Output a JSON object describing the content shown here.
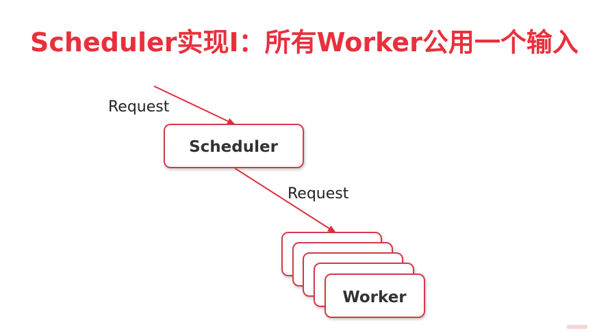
{
  "title": "Scheduler实现I：所有Worker公用一个输入",
  "diagram": {
    "input_label": "Request",
    "scheduler_label": "Scheduler",
    "output_label": "Request",
    "worker_label": "Worker",
    "worker_count": 5,
    "accent_color": "#e8303c"
  }
}
